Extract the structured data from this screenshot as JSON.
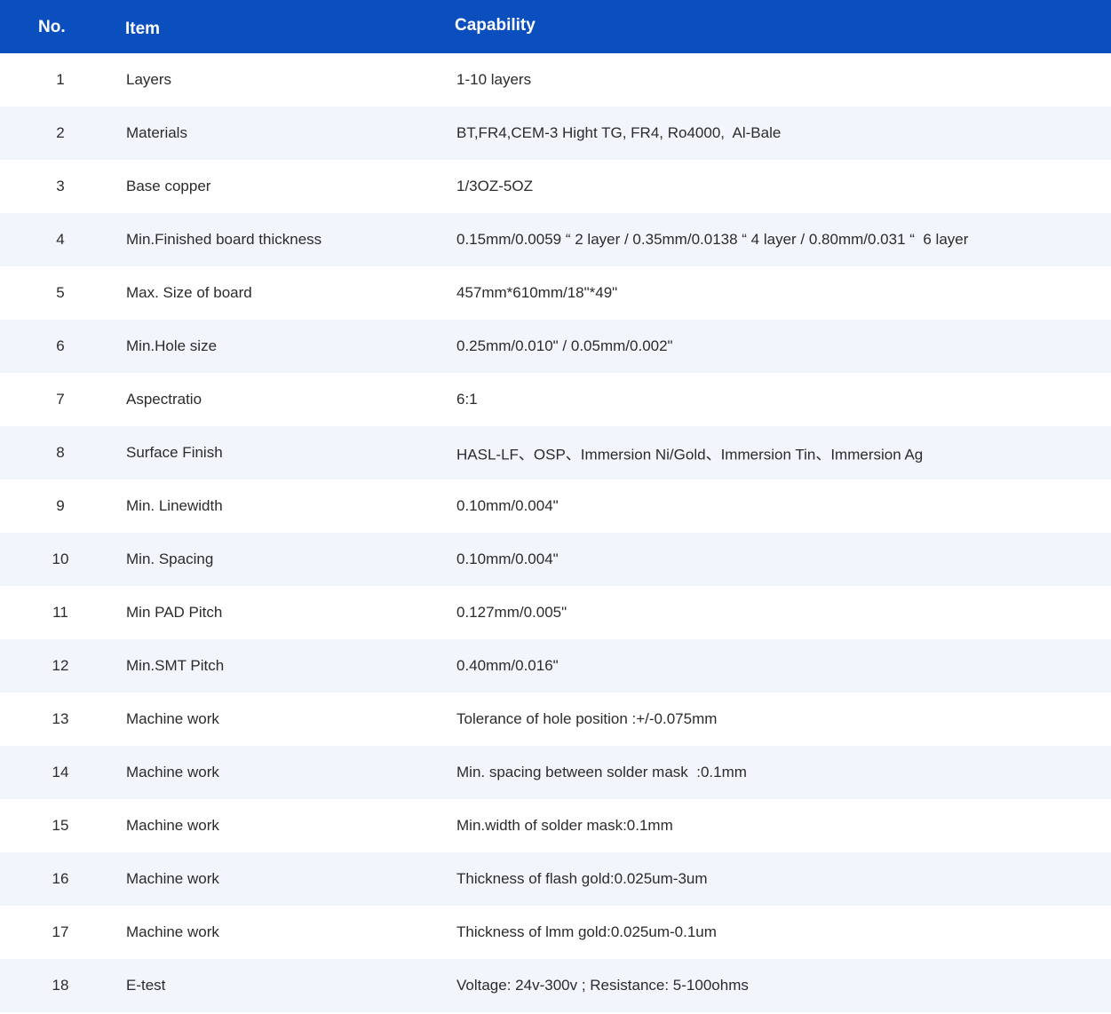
{
  "header": {
    "no": "No.",
    "item": "Item",
    "capability": "Capability"
  },
  "rows": [
    {
      "no": "1",
      "item": "Layers",
      "capability": "1-10 layers"
    },
    {
      "no": "2",
      "item": "Materials",
      "capability": "BT,FR4,CEM-3 Hight TG, FR4, Ro4000,  Al-Bale"
    },
    {
      "no": "3",
      "item": "Base copper",
      "capability": "1/3OZ-5OZ"
    },
    {
      "no": "4",
      "item": "Min.Finished board thickness",
      "capability": "0.15mm/0.0059 “ 2 layer / 0.35mm/0.0138 “ 4 layer / 0.80mm/0.031 “  6 layer"
    },
    {
      "no": "5",
      "item": "Max. Size of board",
      "capability": "457mm*610mm/18\"*49\""
    },
    {
      "no": "6",
      "item": "Min.Hole size",
      "capability": "0.25mm/0.010\" / 0.05mm/0.002\""
    },
    {
      "no": "7",
      "item": "Aspectratio",
      "capability": "6:1"
    },
    {
      "no": "8",
      "item": "Surface Finish",
      "capability": "HASL-LF、OSP、Immersion Ni/Gold、Immersion Tin、Immersion Ag"
    },
    {
      "no": "9",
      "item": "Min. Linewidth",
      "capability": "0.10mm/0.004\""
    },
    {
      "no": "10",
      "item": "Min. Spacing",
      "capability": "0.10mm/0.004\""
    },
    {
      "no": "11",
      "item": "Min PAD Pitch",
      "capability": "0.127mm/0.005\""
    },
    {
      "no": "12",
      "item": "Min.SMT Pitch",
      "capability": "0.40mm/0.016\""
    },
    {
      "no": "13",
      "item": "Machine work",
      "capability": "Tolerance of hole position :+/-0.075mm"
    },
    {
      "no": "14",
      "item": "Machine work",
      "capability": "Min. spacing between solder mask  :0.1mm"
    },
    {
      "no": "15",
      "item": "Machine work",
      "capability": "Min.width of solder mask:0.1mm"
    },
    {
      "no": "16",
      "item": "Machine work",
      "capability": "Thickness of flash gold:0.025um-3um"
    },
    {
      "no": "17",
      "item": "Machine work",
      "capability": "Thickness of lmm gold:0.025um-0.1um"
    },
    {
      "no": "18",
      "item": "E-test",
      "capability": "Voltage: 24v-300v ; Resistance: 5-100ohms"
    }
  ]
}
